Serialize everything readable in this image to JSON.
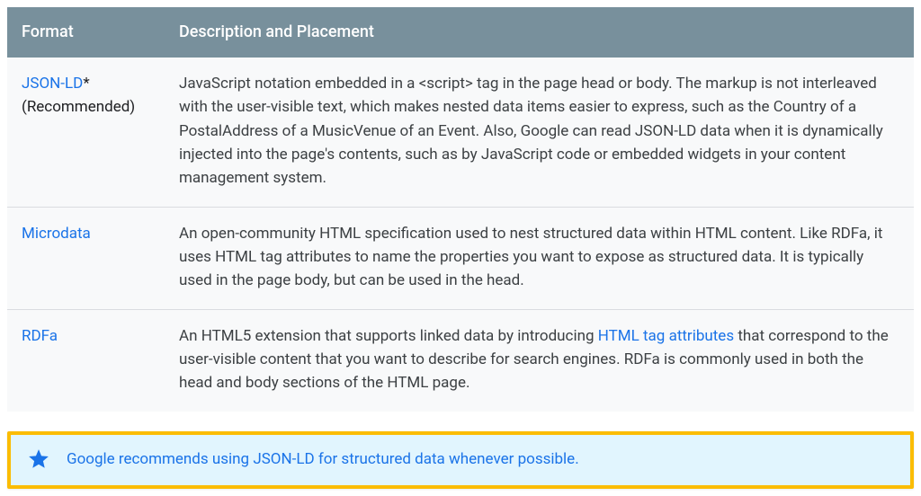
{
  "table": {
    "headers": {
      "format": "Format",
      "description": "Description and Placement"
    },
    "rows": [
      {
        "format_link": "JSON-LD",
        "format_suffix": "*",
        "format_sub": "(Recommended)",
        "desc_before": "JavaScript notation embedded in a <script> tag in the page head or body. The markup is not interleaved with the user-visible text, which makes nested data items easier to express, such as the Country of a PostalAddress of a MusicVenue of an Event. Also, Google can read JSON-LD data when it is dynamically injected into the page's contents, such as by JavaScript code or embedded widgets in your content management system.",
        "desc_link": "",
        "desc_after": ""
      },
      {
        "format_link": "Microdata",
        "format_suffix": "",
        "format_sub": "",
        "desc_before": "An open-community HTML specification used to nest structured data within HTML content. Like RDFa, it uses HTML tag attributes to name the properties you want to expose as structured data. It is typically used in the page body, but can be used in the head.",
        "desc_link": "",
        "desc_after": ""
      },
      {
        "format_link": "RDFa",
        "format_suffix": "",
        "format_sub": "",
        "desc_before": "An HTML5 extension that supports linked data by introducing ",
        "desc_link": "HTML tag attributes",
        "desc_after": " that correspond to the user-visible content that you want to describe for search engines. RDFa is commonly used in both the head and body sections of the HTML page."
      }
    ]
  },
  "callout": {
    "text": "Google recommends using JSON-LD for structured data whenever possible."
  }
}
